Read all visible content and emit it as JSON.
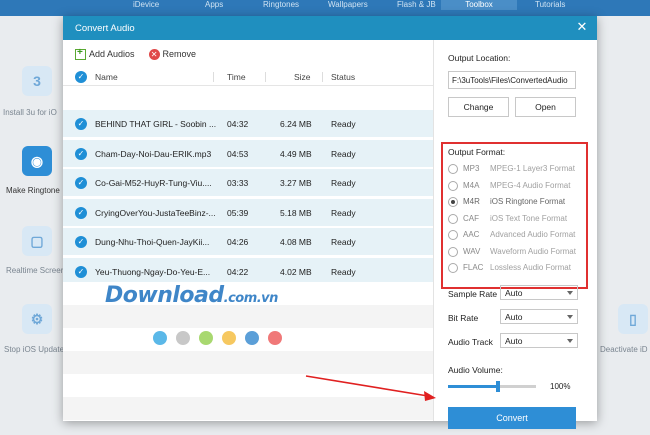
{
  "background": {
    "nav_tabs": [
      "iDevice",
      "Apps",
      "Ringtones",
      "Wallpapers",
      "Flash & JB",
      "Toolbox",
      "Tutorials"
    ],
    "tools": {
      "install": "Install 3u for iO",
      "ringtone": "Make Ringtone",
      "screen": "Realtime Screen",
      "stop_update": "Stop iOS Update",
      "deactivate": "Deactivate iD"
    }
  },
  "dialog": {
    "title": "Convert Audio",
    "close_icon": "close-icon",
    "toolbar": {
      "add_label": "Add Audios",
      "remove_label": "Remove"
    },
    "columns": {
      "name": "Name",
      "time": "Time",
      "size": "Size",
      "status": "Status"
    },
    "files": [
      {
        "name": "BEHIND THAT GIRL - Soobin ...",
        "time": "04:32",
        "size": "6.24 MB",
        "status": "Ready"
      },
      {
        "name": "Cham-Day-Noi-Dau-ERIK.mp3",
        "time": "04:53",
        "size": "4.49 MB",
        "status": "Ready"
      },
      {
        "name": "Co-Gai-M52-HuyR-Tung-Viu....",
        "time": "03:33",
        "size": "3.27 MB",
        "status": "Ready"
      },
      {
        "name": "CryingOverYou-JustaTeeBinz-...",
        "time": "05:39",
        "size": "5.18 MB",
        "status": "Ready"
      },
      {
        "name": "Dung-Nhu-Thoi-Quen-JayKii...",
        "time": "04:26",
        "size": "4.08 MB",
        "status": "Ready"
      },
      {
        "name": "Yeu-Thuong-Ngay-Do-Yeu-E...",
        "time": "04:22",
        "size": "4.02 MB",
        "status": "Ready"
      }
    ],
    "output_location": {
      "label": "Output Location:",
      "path": "F:\\3uTools\\Files\\ConvertedAudio",
      "change_label": "Change",
      "open_label": "Open"
    },
    "output_format": {
      "label": "Output Format:",
      "options": [
        {
          "code": "MP3",
          "desc": "MPEG-1 Layer3 Format",
          "selected": false
        },
        {
          "code": "M4A",
          "desc": "MPEG-4 Audio Format",
          "selected": false
        },
        {
          "code": "M4R",
          "desc": "iOS Ringtone Format",
          "selected": true
        },
        {
          "code": "CAF",
          "desc": "iOS Text Tone Format",
          "selected": false
        },
        {
          "code": "AAC",
          "desc": "Advanced Audio Format",
          "selected": false
        },
        {
          "code": "WAV",
          "desc": "Waveform Audio Format",
          "selected": false
        },
        {
          "code": "FLAC",
          "desc": "Lossless Audio Format",
          "selected": false
        }
      ]
    },
    "settings": {
      "sample_rate": {
        "label": "Sample Rate",
        "value": "Auto"
      },
      "bit_rate": {
        "label": "Bit Rate",
        "value": "Auto"
      },
      "audio_track": {
        "label": "Audio Track",
        "value": "Auto"
      }
    },
    "volume": {
      "label": "Audio Volume:",
      "value_text": "100%",
      "level": 0.57
    },
    "convert_label": "Convert"
  },
  "watermark": {
    "text": "Download",
    "suffix": ".com.vn",
    "dot_colors": [
      "#5bb8e8",
      "#c8c8c8",
      "#a8d870",
      "#f6c860",
      "#5b9fd8",
      "#f07878"
    ]
  },
  "colors": {
    "accent": "#2e8ed6",
    "title_bar": "#1f8fbf",
    "highlight_border": "#e03030",
    "row_bg": "#e6f2f7"
  }
}
